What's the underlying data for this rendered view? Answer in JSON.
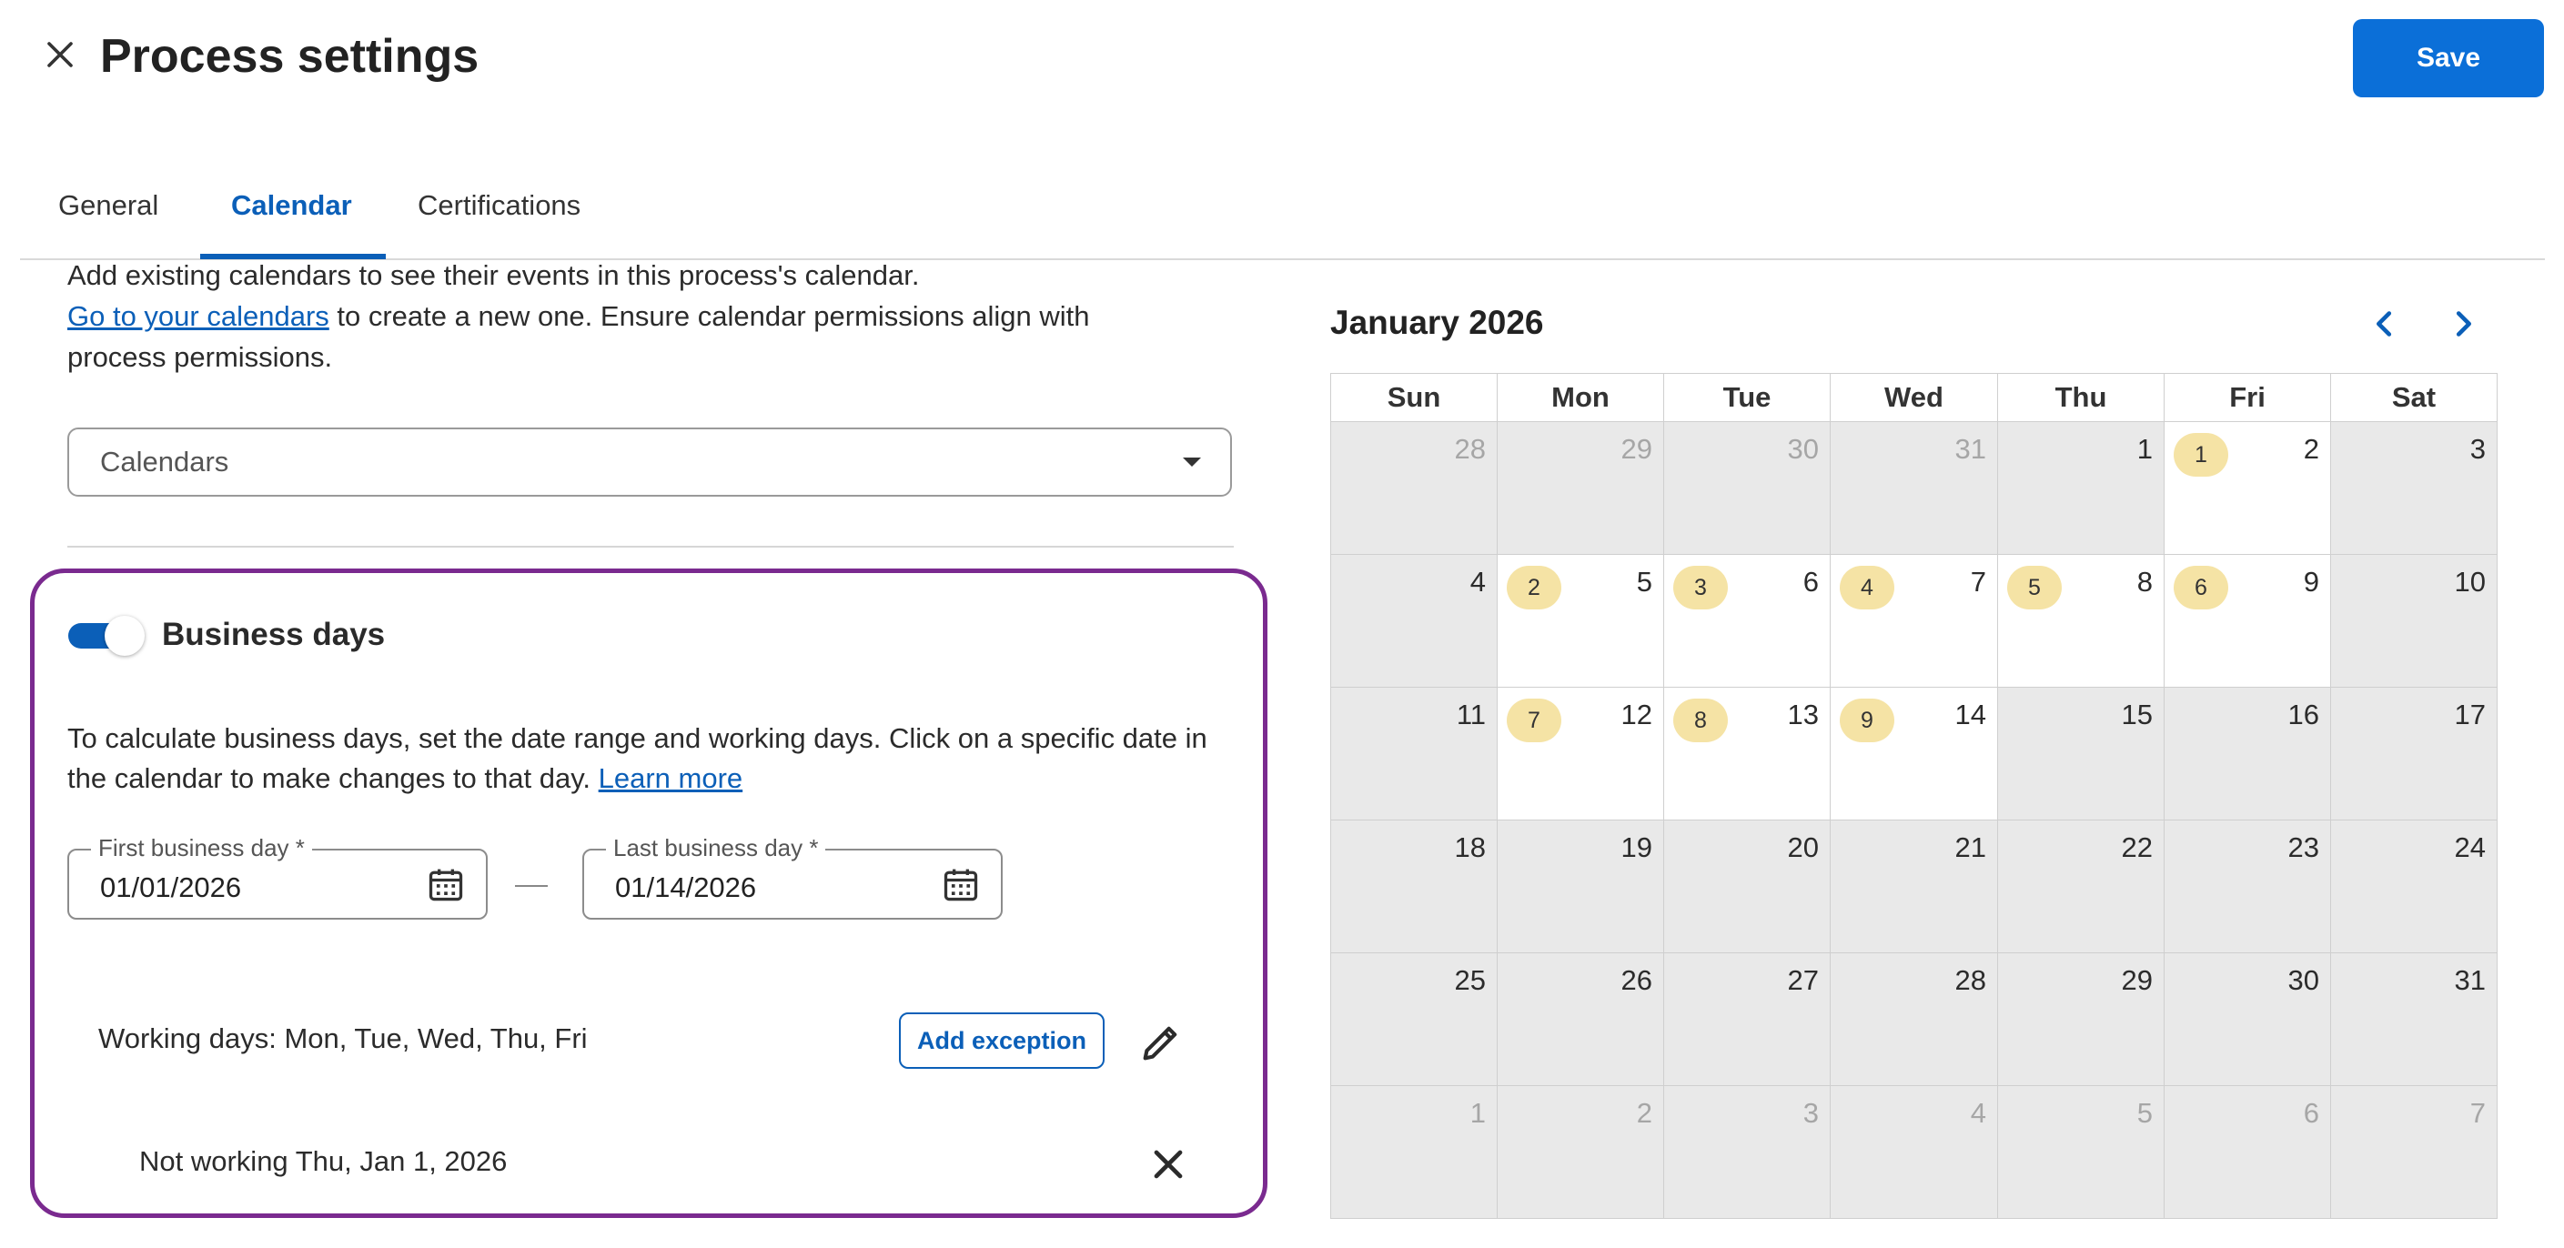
{
  "header": {
    "title": "Process settings",
    "save_label": "Save"
  },
  "tabs": [
    {
      "label": "General",
      "active": false
    },
    {
      "label": "Calendar",
      "active": true
    },
    {
      "label": "Certifications",
      "active": false
    }
  ],
  "calendars_section": {
    "intro_line1": "Add existing calendars to see their events in this process's calendar.",
    "link_text": "Go to your calendars",
    "intro_line2_rest": " to create a new one. Ensure calendar permissions align with",
    "intro_line3": "process permissions.",
    "select_placeholder": "Calendars"
  },
  "business_days": {
    "enabled": true,
    "title": "Business days",
    "description": "To calculate business days, set the date range and working days. Click on a specific date in the calendar to make changes to that day.",
    "learn_more": "Learn more",
    "first_day_label": "First business day *",
    "first_day_value": "01/01/2026",
    "last_day_label": "Last business day *",
    "last_day_value": "01/14/2026",
    "working_days": "Working days: Mon, Tue, Wed, Thu, Fri",
    "add_exception_label": "Add exception",
    "exception_text": "Not working Thu, Jan 1, 2026"
  },
  "calendar": {
    "month_label": "January 2026",
    "weekdays": [
      "Sun",
      "Mon",
      "Tue",
      "Wed",
      "Thu",
      "Fri",
      "Sat"
    ],
    "weeks": [
      [
        {
          "d": "28",
          "other": true
        },
        {
          "d": "29",
          "other": true
        },
        {
          "d": "30",
          "other": true
        },
        {
          "d": "31",
          "other": true
        },
        {
          "d": "1",
          "other": false,
          "active": false
        },
        {
          "d": "2",
          "active": true,
          "badge": "1"
        },
        {
          "d": "3",
          "active": false
        }
      ],
      [
        {
          "d": "4",
          "active": false
        },
        {
          "d": "5",
          "active": true,
          "badge": "2"
        },
        {
          "d": "6",
          "active": true,
          "badge": "3"
        },
        {
          "d": "7",
          "active": true,
          "badge": "4"
        },
        {
          "d": "8",
          "active": true,
          "badge": "5"
        },
        {
          "d": "9",
          "active": true,
          "badge": "6"
        },
        {
          "d": "10",
          "active": false
        }
      ],
      [
        {
          "d": "11",
          "active": false
        },
        {
          "d": "12",
          "active": true,
          "badge": "7"
        },
        {
          "d": "13",
          "active": true,
          "badge": "8"
        },
        {
          "d": "14",
          "active": true,
          "badge": "9"
        },
        {
          "d": "15",
          "active": false
        },
        {
          "d": "16",
          "active": false
        },
        {
          "d": "17",
          "active": false
        }
      ],
      [
        {
          "d": "18"
        },
        {
          "d": "19"
        },
        {
          "d": "20"
        },
        {
          "d": "21"
        },
        {
          "d": "22"
        },
        {
          "d": "23"
        },
        {
          "d": "24"
        }
      ],
      [
        {
          "d": "25"
        },
        {
          "d": "26"
        },
        {
          "d": "27"
        },
        {
          "d": "28"
        },
        {
          "d": "29"
        },
        {
          "d": "30"
        },
        {
          "d": "31"
        }
      ],
      [
        {
          "d": "1",
          "other": true
        },
        {
          "d": "2",
          "other": true
        },
        {
          "d": "3",
          "other": true
        },
        {
          "d": "4",
          "other": true
        },
        {
          "d": "5",
          "other": true
        },
        {
          "d": "6",
          "other": true
        },
        {
          "d": "7",
          "other": true
        }
      ]
    ]
  },
  "colors": {
    "accent": "#0b5fb8",
    "save_button": "#0b6fd8",
    "card_border": "#7a2a8f",
    "badge_fill": "#f5e3a5",
    "inactive_day": "#e9e9e9"
  },
  "icons": {
    "close": "close-icon",
    "dropdown": "caret-down-icon",
    "calendar": "calendar-icon",
    "edit": "pencil-icon",
    "remove": "close-icon",
    "prev": "chevron-left-icon",
    "next": "chevron-right-icon"
  }
}
